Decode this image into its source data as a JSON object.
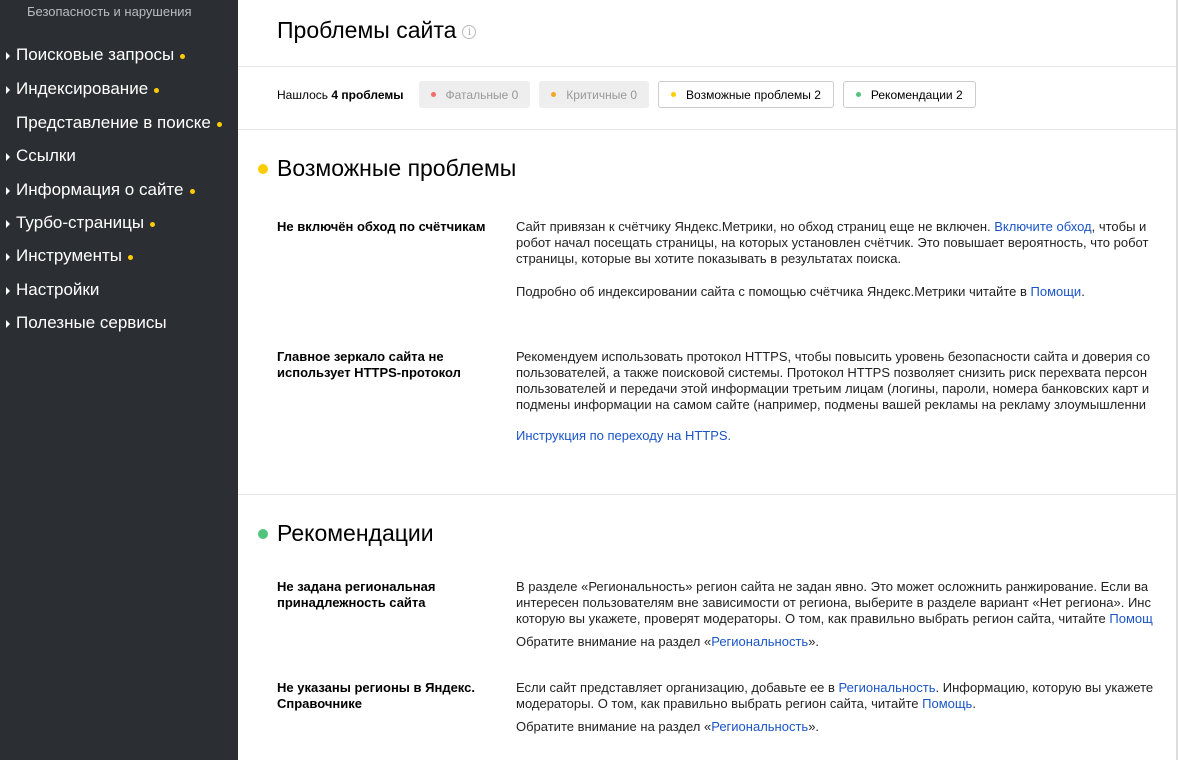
{
  "sidebar": {
    "top_item": "Безопасность и нарушения",
    "items": [
      {
        "label": "Поисковые запросы",
        "arrow": true,
        "dot": true
      },
      {
        "label": "Индексирование",
        "arrow": true,
        "dot": true
      },
      {
        "label": "Представление в поиске",
        "arrow": false,
        "dot": true
      },
      {
        "label": "Ссылки",
        "arrow": true,
        "dot": false
      },
      {
        "label": "Информация о сайте",
        "arrow": true,
        "dot": true
      },
      {
        "label": "Турбо-страницы",
        "arrow": true,
        "dot": true
      },
      {
        "label": "Инструменты",
        "arrow": true,
        "dot": true
      },
      {
        "label": "Настройки",
        "arrow": true,
        "dot": false
      },
      {
        "label": "Полезные сервисы",
        "arrow": true,
        "dot": false
      }
    ]
  },
  "header": {
    "title": "Проблемы сайта",
    "info_icon": "i"
  },
  "filters": {
    "found_prefix": "Нашлось",
    "found_count": "4 проблемы",
    "chips": [
      {
        "label": "Фатальные 0",
        "dot_color": "#f26c6c",
        "state": "disabled"
      },
      {
        "label": "Критичные 0",
        "dot_color": "#f5a623",
        "state": "disabled"
      },
      {
        "label": "Возможные проблемы 2",
        "dot_color": "#ffcc00",
        "state": "active"
      },
      {
        "label": "Рекомендации 2",
        "dot_color": "#52c37a",
        "state": "active"
      }
    ]
  },
  "sections": {
    "possible": {
      "title": "Возможные проблемы",
      "dot_color": "#ffcc00",
      "issues": [
        {
          "title": "Не включён обход по счётчикам",
          "p1_a": "Сайт привязан к счётчику Яндекс.Метрики, но обход страниц еще не включен. ",
          "p1_link": "Включите обход",
          "p1_b": ", чтобы и",
          "p1_line2": "робот начал посещать страницы, на которых установлен счётчик. Это повышает вероятность, что робот",
          "p1_line3": "страницы, которые вы хотите показывать в результатах поиска.",
          "p2_a": "Подробно об индексировании сайта с помощью счётчика Яндекс.Метрики читайте в ",
          "p2_link": "Помощи",
          "p2_b": "."
        },
        {
          "title": "Главное зеркало сайта не использует HTTPS-протокол",
          "line1": "Рекомендуем использовать протокол HTTPS, чтобы повысить уровень безопасности сайта и доверия со",
          "line2": "пользователей, а также поисковой системы. Протокол HTTPS позволяет снизить риск перехвата персон",
          "line3": "пользователей и передачи этой информации третьим лицам (логины, пароли, номера банковских карт и",
          "line4": "подмены информации на самом сайте (например, подмены вашей рекламы на рекламу злоумышленни",
          "link": "Инструкция по переходу на HTTPS."
        }
      ]
    },
    "recommendations": {
      "title": "Рекомендации",
      "dot_color": "#52c37a",
      "issues": [
        {
          "title": "Не задана региональная принадлежность сайта",
          "line1": "В разделе «Региональность» регион сайта не задан явно. Это может осложнить ранжирование. Если ва",
          "line2": "интересен пользователям вне зависимости от региона, выберите в разделе вариант «Нет региона». Инс",
          "line3_a": "которую вы укажете, проверят модераторы. О том, как правильно выбрать регион сайта, читайте ",
          "line3_link": "Помощ",
          "note_a": "Обратите внимание на раздел «",
          "note_link": "Региональность",
          "note_b": "»."
        },
        {
          "title": "Не указаны регионы в Яндекс. Справочнике",
          "line1_a": "Если сайт представляет организацию, добавьте ее в ",
          "line1_link": "Региональность",
          "line1_b": ". Информацию, которую вы укажете",
          "line2_a": "модераторы. О том, как правильно выбрать регион сайта, читайте ",
          "line2_link": "Помощь",
          "line2_b": ".",
          "note_a": "Обратите внимание на раздел «",
          "note_link": "Региональность",
          "note_b": "»."
        }
      ]
    }
  }
}
